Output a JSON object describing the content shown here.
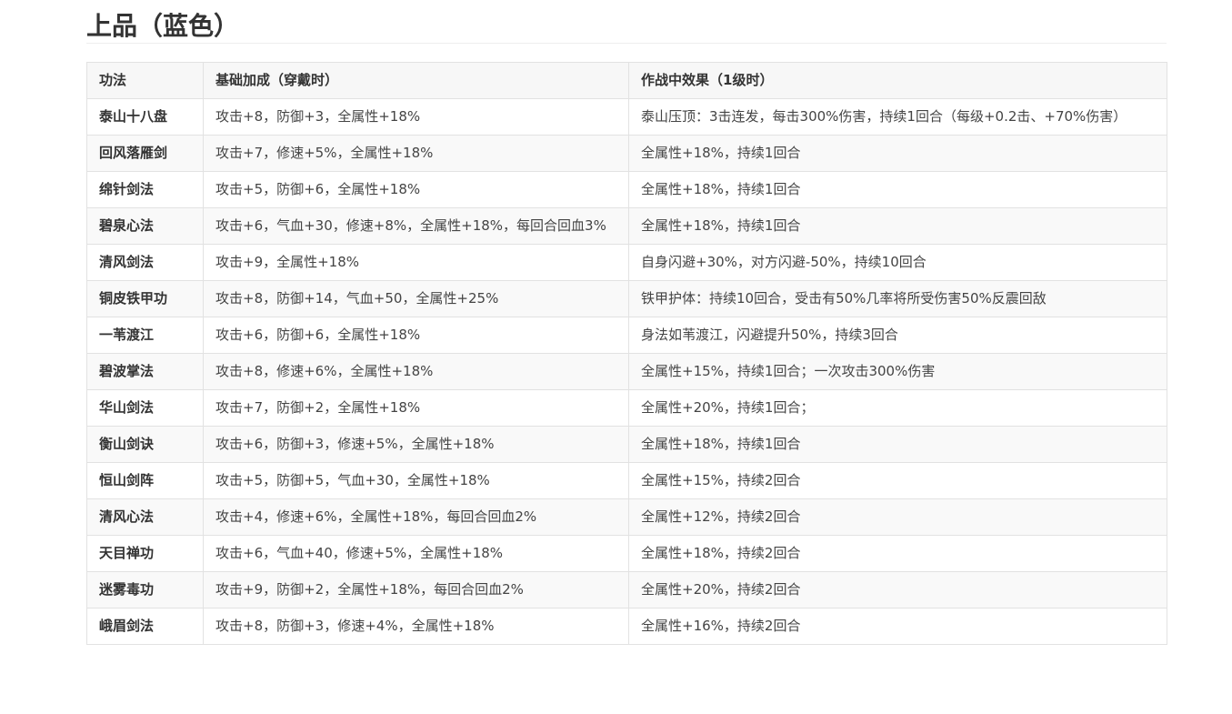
{
  "section_title": "上品（蓝色）",
  "table": {
    "headers": [
      "功法",
      "基础加成（穿戴时）",
      "作战中效果（1级时）"
    ],
    "rows": [
      {
        "name": "泰山十八盘",
        "bonus": "攻击+8，防御+3，全属性+18%",
        "effect": "泰山压顶：3击连发，每击300%伤害，持续1回合（每级+0.2击、+70%伤害）"
      },
      {
        "name": "回风落雁剑",
        "bonus": "攻击+7，修速+5%，全属性+18%",
        "effect": "全属性+18%，持续1回合"
      },
      {
        "name": "绵针剑法",
        "bonus": "攻击+5，防御+6，全属性+18%",
        "effect": "全属性+18%，持续1回合"
      },
      {
        "name": "碧泉心法",
        "bonus": "攻击+6，气血+30，修速+8%，全属性+18%，每回合回血3%",
        "effect": "全属性+18%，持续1回合"
      },
      {
        "name": "清风剑法",
        "bonus": "攻击+9，全属性+18%",
        "effect": "自身闪避+30%，对方闪避-50%，持续10回合"
      },
      {
        "name": "铜皮铁甲功",
        "bonus": "攻击+8，防御+14，气血+50，全属性+25%",
        "effect": "铁甲护体：持续10回合，受击有50%几率将所受伤害50%反震回敌"
      },
      {
        "name": "一苇渡江",
        "bonus": "攻击+6，防御+6，全属性+18%",
        "effect": "身法如苇渡江，闪避提升50%，持续3回合"
      },
      {
        "name": "碧波掌法",
        "bonus": "攻击+8，修速+6%，全属性+18%",
        "effect": "全属性+15%，持续1回合；一次攻击300%伤害"
      },
      {
        "name": "华山剑法",
        "bonus": "攻击+7，防御+2，全属性+18%",
        "effect": "全属性+20%，持续1回合；"
      },
      {
        "name": "衡山剑诀",
        "bonus": "攻击+6，防御+3，修速+5%，全属性+18%",
        "effect": "全属性+18%，持续1回合"
      },
      {
        "name": "恒山剑阵",
        "bonus": "攻击+5，防御+5，气血+30，全属性+18%",
        "effect": "全属性+15%，持续2回合"
      },
      {
        "name": "清风心法",
        "bonus": "攻击+4，修速+6%，全属性+18%，每回合回血2%",
        "effect": "全属性+12%，持续2回合"
      },
      {
        "name": "天目禅功",
        "bonus": "攻击+6，气血+40，修速+5%，全属性+18%",
        "effect": "全属性+18%，持续2回合"
      },
      {
        "name": "迷雾毒功",
        "bonus": "攻击+9，防御+2，全属性+18%，每回合回血2%",
        "effect": "全属性+20%，持续2回合"
      },
      {
        "name": "峨眉剑法",
        "bonus": "攻击+8，防御+3，修速+4%，全属性+18%",
        "effect": "全属性+16%，持续2回合"
      }
    ]
  }
}
